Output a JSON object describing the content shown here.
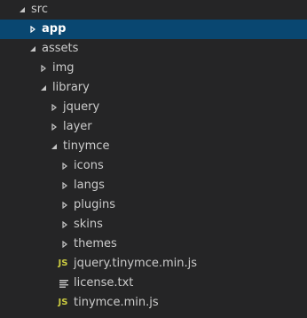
{
  "explorer": {
    "items": [
      {
        "label": "src",
        "kind": "folder",
        "expanded": true,
        "icon": "chevron-down-icon"
      },
      {
        "label": "app",
        "kind": "folder",
        "expanded": false,
        "selected": true,
        "icon": "chevron-right-icon"
      },
      {
        "label": "assets",
        "kind": "folder",
        "expanded": true,
        "icon": "chevron-down-icon"
      },
      {
        "label": "img",
        "kind": "folder",
        "expanded": false,
        "icon": "chevron-right-icon"
      },
      {
        "label": "library",
        "kind": "folder",
        "expanded": true,
        "icon": "chevron-down-icon"
      },
      {
        "label": "jquery",
        "kind": "folder",
        "expanded": false,
        "icon": "chevron-right-icon"
      },
      {
        "label": "layer",
        "kind": "folder",
        "expanded": false,
        "icon": "chevron-right-icon"
      },
      {
        "label": "tinymce",
        "kind": "folder",
        "expanded": true,
        "icon": "chevron-down-icon"
      },
      {
        "label": "icons",
        "kind": "folder",
        "expanded": false,
        "icon": "chevron-right-icon"
      },
      {
        "label": "langs",
        "kind": "folder",
        "expanded": false,
        "icon": "chevron-right-icon"
      },
      {
        "label": "plugins",
        "kind": "folder",
        "expanded": false,
        "icon": "chevron-right-icon"
      },
      {
        "label": "skins",
        "kind": "folder",
        "expanded": false,
        "icon": "chevron-right-icon"
      },
      {
        "label": "themes",
        "kind": "folder",
        "expanded": false,
        "icon": "chevron-right-icon"
      },
      {
        "label": "jquery.tinymce.min.js",
        "kind": "file",
        "file_icon": "JS",
        "icon": "js-file-icon"
      },
      {
        "label": "license.txt",
        "kind": "file",
        "file_icon": "",
        "icon": "text-file-icon"
      },
      {
        "label": "tinymce.min.js",
        "kind": "file",
        "file_icon": "JS",
        "icon": "js-file-icon"
      }
    ]
  },
  "colors": {
    "background": "#252526",
    "selection": "#094771",
    "text": "#cccccc",
    "js_icon": "#cbcb41"
  }
}
